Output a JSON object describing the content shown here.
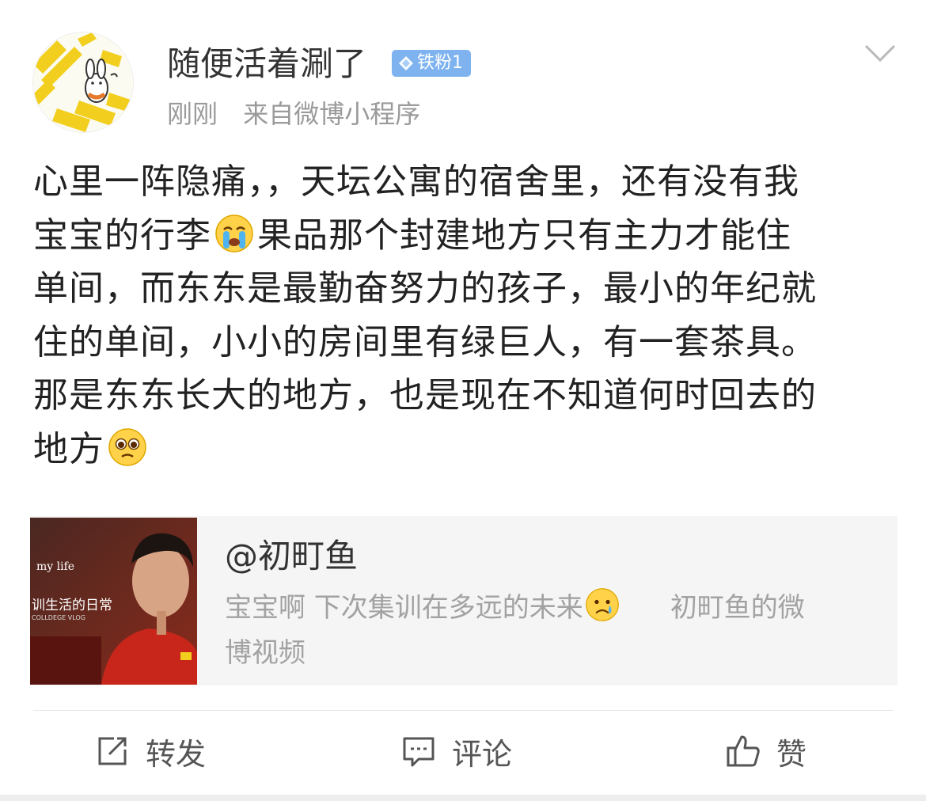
{
  "post": {
    "username": "随便活着涮了",
    "badge": "铁粉1",
    "time": "刚刚",
    "source": "来自微博小程序",
    "content_lines": [
      "心里一阵隐痛，，天坛公寓的宿舍里，还有没有我",
      "宝宝的行李",
      "果品那个封建地方只有主力才能住",
      "单间，而东东是最勤奋努力的孩子，最小的年纪就",
      "住的单间，小小的房间里有绿巨人，有一套茶具。",
      "那是东东长大的地方，也是现在不知道何时回去的",
      "地方"
    ]
  },
  "card": {
    "title": "@初町鱼",
    "desc_part1": "宝宝啊 下次集训在多远的未来",
    "desc_part2": "初町鱼的微",
    "desc_part3": "博视频",
    "thumb_text_1": "my life",
    "thumb_text_2": "训生活的日常",
    "thumb_text_3": "COLLDEGE VLOG"
  },
  "actions": {
    "repost": "转发",
    "comment": "评论",
    "like": "赞"
  }
}
